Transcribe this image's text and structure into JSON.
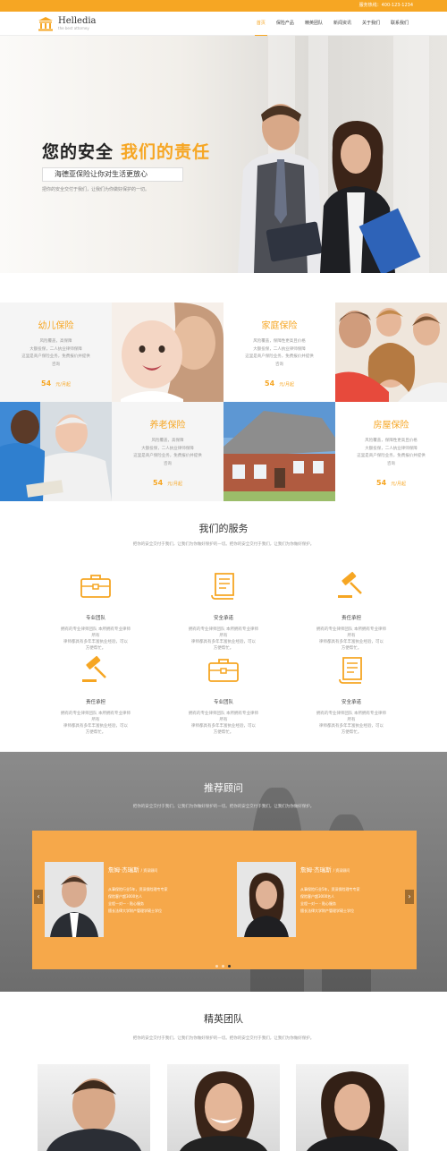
{
  "colors": {
    "accent": "#f6a623",
    "slider_bg": "#f6a84a"
  },
  "topbar": {
    "hotline": "服务热线：400-123-1234"
  },
  "header": {
    "logo_name": "Helledia",
    "logo_sub": "the best attorney",
    "nav": [
      "首页",
      "保险产品",
      "精英团队",
      "新闻资讯",
      "关于我们",
      "联系我们"
    ]
  },
  "hero": {
    "title_dark": "您的安全",
    "title_orange": "我们的责任",
    "tagline": "海德亚保险让你对生活更放心",
    "sub": "把你的安全交付于我们，让我们为你做好保护的一切。"
  },
  "products": [
    {
      "name": "幼儿保险",
      "lines": [
        "风险覆盖，高保障",
        "大额投保，二人执业律师保障",
        "这里是商户保险业务，免费报价并提供",
        "咨询"
      ],
      "price": "54",
      "unit": "元/月起"
    },
    {
      "name": "家庭保险",
      "lines": [
        "风险覆盖，保障性更高且价格",
        "大额投保，二人执业律师保障",
        "这里是商户保险业务，免费报价并提供",
        "咨询"
      ],
      "price": "54",
      "unit": "元/月起"
    },
    {
      "name": "养老保险",
      "lines": [
        "风险覆盖，高保障",
        "大额投保，二人执业律师保障",
        "这里是商户保险业务，免费报价并提供",
        "咨询"
      ],
      "price": "54",
      "unit": "元/月起"
    },
    {
      "name": "房屋保险",
      "lines": [
        "风险覆盖，保障性更高且价格",
        "大额投保，二人执业律师保障",
        "这里是商户保险业务，免费报价并提供",
        "咨询"
      ],
      "price": "54",
      "unit": "元/月起"
    }
  ],
  "services": {
    "title": "我们的服务",
    "desc": "把你的安全交付于我们，让我们为你做好保护的一切。把你的安全交付于我们，让我们为你做好保护。",
    "items": [
      {
        "icon": "briefcase-icon",
        "name": "专业团队",
        "text": [
          "拥有的专业律师团队 本所拥有专业律师  所有",
          "律师都具有多年丰富执业经验，可以",
          "方便帮忙。"
        ]
      },
      {
        "icon": "scroll-icon",
        "name": "安全承诺",
        "text": [
          "拥有的专业律师团队 本所拥有专业律师  所有",
          "律师都具有多年丰富执业经验，可以",
          "方便帮忙。"
        ]
      },
      {
        "icon": "gavel-icon",
        "name": "责任承担",
        "text": [
          "拥有的专业律师团队 本所拥有专业律师  所有",
          "律师都具有多年丰富执业经验，可以",
          "方便帮忙。"
        ]
      },
      {
        "icon": "gavel-icon",
        "name": "责任承担",
        "text": [
          "拥有的专业律师团队 本所拥有专业律师  所有",
          "律师都具有多年丰富执业经验，可以",
          "方便帮忙。"
        ]
      },
      {
        "icon": "briefcase-icon",
        "name": "专业团队",
        "text": [
          "拥有的专业律师团队 本所拥有专业律师  所有",
          "律师都具有多年丰富执业经验，可以",
          "方便帮忙。"
        ]
      },
      {
        "icon": "scroll-icon",
        "name": "安全承诺",
        "text": [
          "拥有的专业律师团队 本所拥有专业律师  所有",
          "律师都具有多年丰富执业经验，可以",
          "方便帮忙。"
        ]
      }
    ]
  },
  "advisors": {
    "title": "推荐顾问",
    "desc": "把你的安全交付于我们，让我们为你做好保护的一切。把你的安全交付于我们，让我们为你做好保护。",
    "items": [
      {
        "name": "詹姆·杰瑞斯",
        "role": "/ 资深顾问",
        "lines": [
          "从事保险行业5年，资深保险理专专家",
          "保险客户超3000名人",
          "全程一对一 - 贴心服务",
          "擅长法律大学财产管理学硕士学位"
        ]
      },
      {
        "name": "詹姆·杰瑞斯",
        "role": "/ 资深顾问",
        "lines": [
          "从事保险行业5年，资深保险理专专家",
          "保险客户超3000名人",
          "全程一对一 - 贴心服务",
          "擅长法律大学财产管理学硕士学位"
        ]
      }
    ],
    "prev": "‹",
    "next": "›"
  },
  "team": {
    "title": "精英团队",
    "desc": "把你的安全交付于我们，让我们为你做好保护的一切。把你的安全交付于我们，让我们为你做好保护。"
  }
}
